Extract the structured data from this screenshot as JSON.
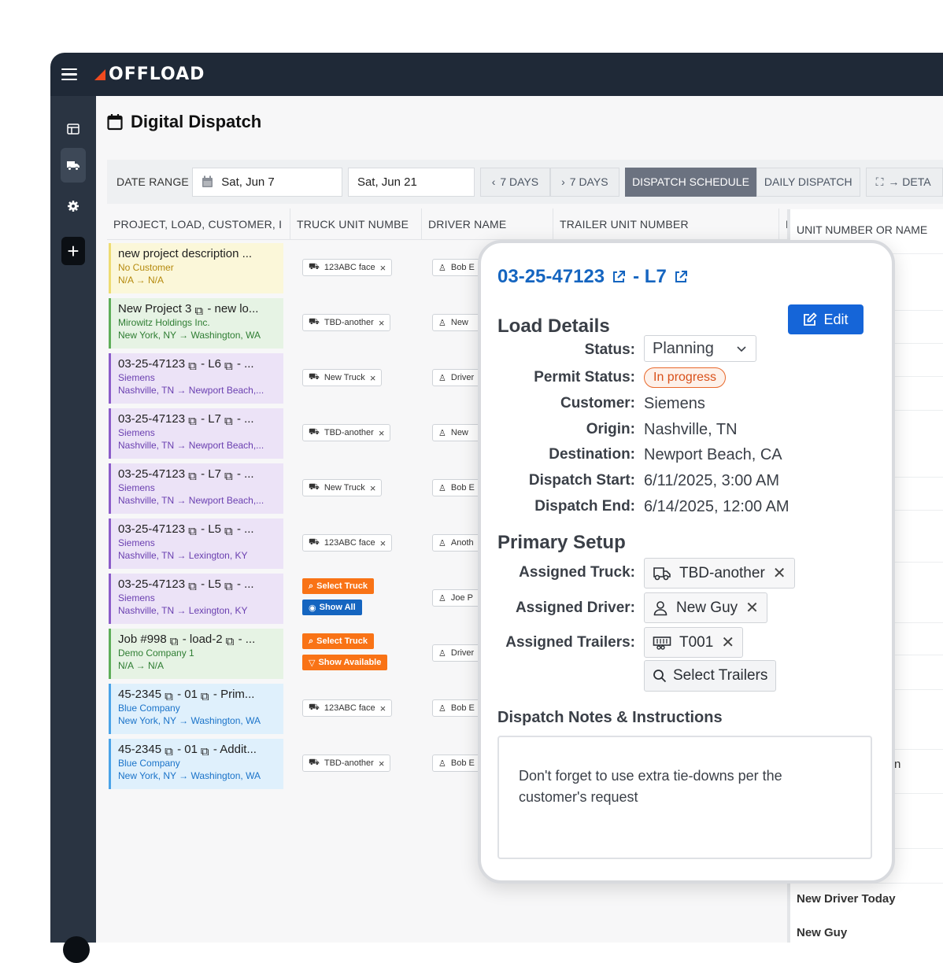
{
  "app": {
    "logo_text": "OFFLOAD",
    "brand_color": "#f04a1f"
  },
  "sidebar": {
    "items": [
      {
        "name": "table-icon"
      },
      {
        "name": "truck-icon"
      },
      {
        "name": "gear-icon"
      },
      {
        "name": "plus-icon"
      }
    ]
  },
  "page": {
    "title": "Digital Dispatch"
  },
  "toolbar": {
    "date_range_label": "DATE RANGE",
    "start_date": "Sat, Jun 7",
    "end_date": "Sat, Jun 21",
    "prev_label": "7 DAYS",
    "next_label": "7 DAYS",
    "dispatch_schedule": "DISPATCH SCHEDULE",
    "daily_dispatch": "DAILY DISPATCH",
    "details": "→ DETA"
  },
  "grid": {
    "headers": [
      "PROJECT, LOAD, CUSTOMER, I",
      "TRUCK UNIT NUMBE",
      "DRIVER NAME",
      "TRAILER UNIT NUMBER",
      "D"
    ],
    "rows": [
      {
        "l1": "new project description ...",
        "l2": "No Customer",
        "l3": "N/A → N/A",
        "truck": "123ABC face",
        "driver": "Bob E"
      },
      {
        "l1": "New Project 3",
        "l1b": "- new lo...",
        "l2": "Mirowitz Holdings Inc.",
        "l3": "New York, NY → Washington, WA",
        "truck": "TBD-another",
        "driver": "New"
      },
      {
        "l1": "03-25-47123",
        "l1b": "- L6",
        "l1c": "- ...",
        "l2": "Siemens",
        "l3": "Nashville, TN → Newport Beach,...",
        "truck": "New Truck",
        "driver": "Driver"
      },
      {
        "l1": "03-25-47123",
        "l1b": "- L7",
        "l1c": "- ...",
        "l2": "Siemens",
        "l3": "Nashville, TN → Newport Beach,...",
        "truck": "TBD-another",
        "driver": "New"
      },
      {
        "l1": "03-25-47123",
        "l1b": "- L7",
        "l1c": "- ...",
        "l2": "Siemens",
        "l3": "Nashville, TN → Newport Beach,...",
        "truck": "New Truck",
        "driver": "Bob E"
      },
      {
        "l1": "03-25-47123",
        "l1b": "- L5",
        "l1c": "- ...",
        "l2": "Siemens",
        "l3": "Nashville, TN → Lexington, KY",
        "truck": "123ABC face",
        "driver": "Anoth"
      },
      {
        "l1": "03-25-47123",
        "l1b": "- L5",
        "l1c": "- ...",
        "l2": "Siemens",
        "l3": "Nashville, TN → Lexington, KY",
        "select_truck": "Select Truck",
        "show_all": "Show All",
        "driver": "Joe P"
      },
      {
        "l1": "Job #998",
        "l1b": "- load-2",
        "l1c": "- ...",
        "l2": "Demo Company 1",
        "l3": "N/A → N/A",
        "select_truck": "Select Truck",
        "show_available": "Show Available",
        "driver": "Driver"
      },
      {
        "l1": "45-2345",
        "l1b": "- 01",
        "l1c": "- Prim...",
        "l2": "Blue Company",
        "l3": "New York, NY → Washington, WA",
        "truck": "123ABC face",
        "driver": "Bob E"
      },
      {
        "l1": "45-2345",
        "l1b": "- 01",
        "l1c": "- Addit...",
        "l2": "Blue Company",
        "l3": "New York, NY → Washington, WA",
        "truck": "TBD-another",
        "driver": "Bob E"
      }
    ]
  },
  "right_column": {
    "header": "UNIT NUMBER OR NAME",
    "items": [
      "New Driver Today",
      "New Guy"
    ],
    "fragments": [
      ",",
      "n"
    ]
  },
  "popup": {
    "load_number": "03-25-47123",
    "load_suffix": "- L7",
    "edit_label": "Edit",
    "section_load": "Load Details",
    "status_label": "Status:",
    "status_value": "Planning",
    "permit_label": "Permit Status:",
    "permit_value": "In progress",
    "customer_label": "Customer:",
    "customer_value": "Siemens",
    "origin_label": "Origin:",
    "origin_value": "Nashville, TN",
    "destination_label": "Destination:",
    "destination_value": "Newport Beach, CA",
    "start_label": "Dispatch Start:",
    "start_value": "6/11/2025, 3:00 AM",
    "end_label": "Dispatch End:",
    "end_value": "6/14/2025, 12:00 AM",
    "section_setup": "Primary Setup",
    "truck_label": "Assigned Truck:",
    "truck_value": "TBD-another",
    "driver_label": "Assigned Driver:",
    "driver_value": "New Guy",
    "trailers_label": "Assigned Trailers:",
    "trailer_value": "T001",
    "select_trailers": "Select Trailers",
    "notes_title": "Dispatch Notes & Instructions",
    "notes_text": "Don't forget to use extra tie-downs per the customer's request"
  },
  "colors": {
    "accent_blue": "#1565c0",
    "orange": "#f97316",
    "dark_nav": "#1f2937"
  }
}
